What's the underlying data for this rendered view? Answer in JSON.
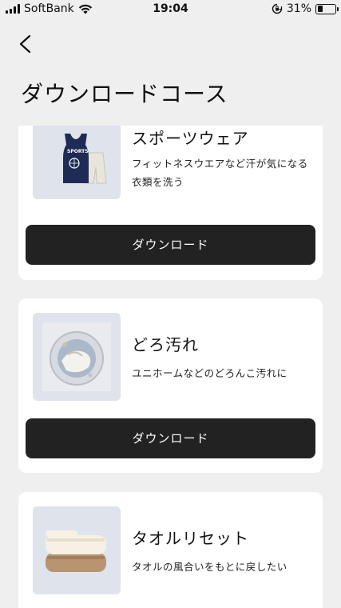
{
  "status_bar": {
    "carrier": "SoftBank",
    "time": "19:04",
    "battery": "31%",
    "battery_level": 0.31
  },
  "header": {
    "back_icon": "chevron-left-icon",
    "title": "ダウンロードコース"
  },
  "courses": [
    {
      "title": "スポーツウェア",
      "description": "フィットネスウエアなど汗が気になる衣類を洗う",
      "image": "sportswear-jersey-icon",
      "button_label": "ダウンロード"
    },
    {
      "title": "どろ汚れ",
      "description": "ユニホームなどのどろんこ汚れに",
      "image": "muddy-laundry-icon",
      "button_label": "ダウンロード"
    },
    {
      "title": "タオルリセット",
      "description": "タオルの風合いをもとに戻したい",
      "image": "folded-towels-icon",
      "button_label": ""
    }
  ],
  "colors": {
    "background": "#efefef",
    "card": "#ffffff",
    "button": "#222222",
    "thumb_bg": "#dfe3ec"
  }
}
